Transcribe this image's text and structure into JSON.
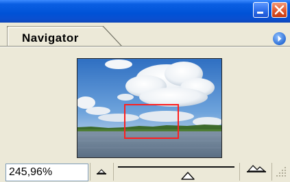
{
  "window": {
    "title_bar_color": "#0a55d8",
    "minimize_icon": "minimize-icon",
    "close_icon": "close-icon"
  },
  "panel": {
    "tab_label": "Navigator",
    "menu_icon": "panel-menu-icon"
  },
  "preview": {
    "image_description_icon": "sky-clouds-lake-thumbnail",
    "view_box_color": "#ff1e1e"
  },
  "footer": {
    "zoom_value": "245,96%",
    "zoom_out_icon": "zoom-out-mountain-icon",
    "zoom_in_icon": "zoom-in-mountain-icon",
    "slider_level": 0.6
  }
}
